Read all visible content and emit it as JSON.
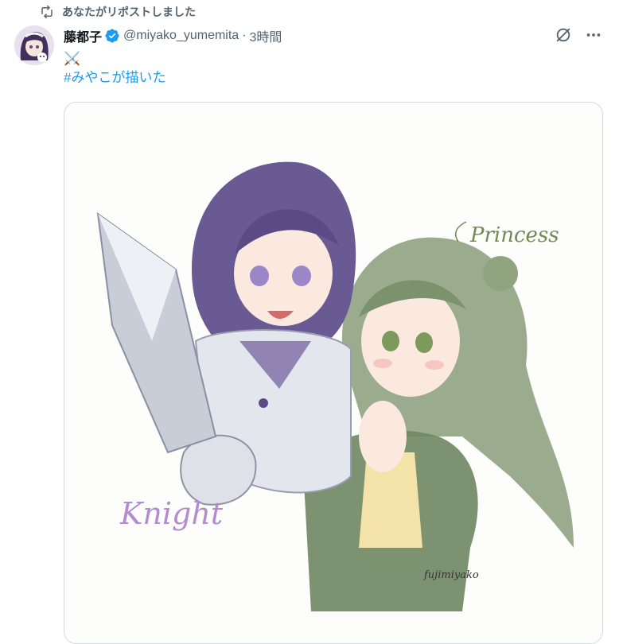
{
  "repost": {
    "label": "あなたがリポストしました"
  },
  "author": {
    "name": "藤都子",
    "handle": "@miyako_yumemita",
    "separator": "·",
    "time": "3時間"
  },
  "tweet": {
    "emoji": "⚔️",
    "hashtag": "#みやこが描いた"
  },
  "image": {
    "label_princess": "Princess",
    "label_knight": "Knight",
    "signature": "fujimiyako"
  },
  "colors": {
    "accent": "#1d9bf0",
    "muted": "#536471",
    "text": "#0f1419",
    "border": "#cfd9de"
  },
  "icons": [
    "repost-icon",
    "verified-icon",
    "grok-icon",
    "more-icon",
    "crossed-swords-icon"
  ]
}
